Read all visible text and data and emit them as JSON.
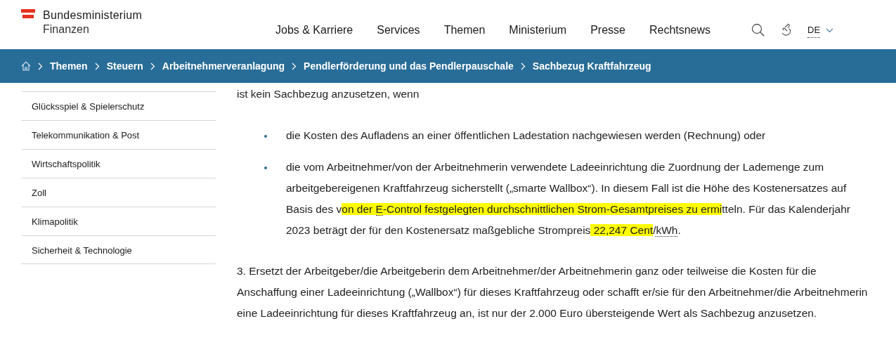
{
  "logo": {
    "line1": "Bundesministerium",
    "line2": "Finanzen"
  },
  "nav": [
    "Jobs & Karriere",
    "Services",
    "Themen",
    "Ministerium",
    "Presse",
    "Rechtsnews"
  ],
  "language": "DE",
  "breadcrumb": [
    "Themen",
    "Steuern",
    "Arbeitnehmerveranlagung",
    "Pendlerförderung und das Pendlerpauschale",
    "Sachbezug Kraftfahrzeug"
  ],
  "sidebar": [
    "Glücksspiel & Spielerschutz",
    "Telekommunikation & Post",
    "Wirtschaftspolitik",
    "Zoll",
    "Klimapolitik",
    "Sicherheit & Technologie"
  ],
  "intro": "ist kein Sachbezug anzusetzen, wenn",
  "bullets": [
    [
      {
        "text": "die Kosten des Aufladens an einer öffentlichen Ladestation nachgewiesen werden (Rechnung) oder",
        "highlight": false,
        "abbr": false
      }
    ],
    [
      {
        "text": "die vom Arbeitnehmer/von der Arbeitnehmerin verwendete Ladeeinrichtung die Zuordnung der Lademenge zum arbeitgebereigenen Kraftfahrzeug sicherstellt („smarte Wallbox“). In diesem Fall ist die Höhe des Kostenersatzes auf Basis des v",
        "highlight": false,
        "abbr": false
      },
      {
        "text": "on der ",
        "highlight": true,
        "abbr": false
      },
      {
        "text": "E",
        "highlight": true,
        "abbr": true
      },
      {
        "text": "-Control festgelegten durchschnittlichen Strom-Gesamtpreises zu ermi",
        "highlight": true,
        "abbr": false
      },
      {
        "text": "tteln. Für das Kalenderjahr 2023 beträgt der für den Kostenersatz maßgebliche Strompreis",
        "highlight": false,
        "abbr": false
      },
      {
        "text": " 22,247 Cent",
        "highlight": true,
        "abbr": false
      },
      {
        "text": "/",
        "highlight": false,
        "abbr": false
      },
      {
        "text": "kWh",
        "highlight": false,
        "abbr": true
      },
      {
        "text": ".",
        "highlight": false,
        "abbr": false
      }
    ]
  ],
  "paragraph": "3. Ersetzt der Arbeitgeber/die Arbeitgeberin dem Arbeitnehmer/der Arbeitnehmerin ganz oder teilweise die Kosten für die Anschaffung einer Ladeeinrichtung („Wallbox“) für dieses Kraftfahrzeug oder schafft er/sie für den Arbeitnehmer/die Arbeitnehmerin eine Ladeeinrichtung für dieses Kraftfahrzeug an, ist nur der 2.000 Euro übersteigende Wert als Sachbezug anzusetzen."
}
